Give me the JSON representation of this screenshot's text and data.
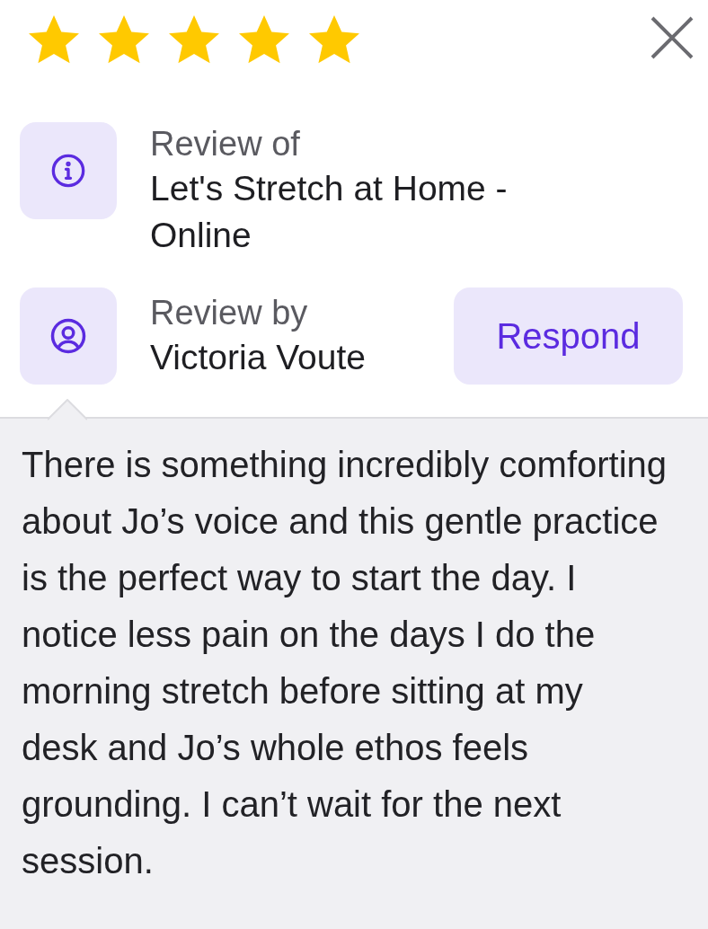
{
  "rating": {
    "stars": 5
  },
  "review_of": {
    "label": "Review of",
    "value": "Let's Stretch at Home - Online"
  },
  "review_by": {
    "label": "Review by",
    "value": "Victoria Voute"
  },
  "respond_button": {
    "label": "Respond"
  },
  "review_text": "There is something incredibly comforting about Jo’s voice and this gentle practice is the perfect way to start the day. I notice less pain on the days I do the morning stretch before sitting at my desk and Jo’s whole ethos feels grounding. I can’t wait for the next session."
}
